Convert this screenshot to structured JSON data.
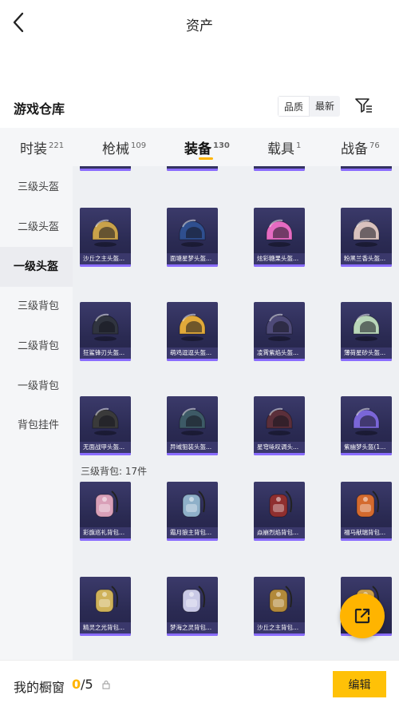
{
  "header": {
    "title": "资产",
    "back_icon": "chevron-left-icon"
  },
  "section": {
    "title": "游戏仓库",
    "sort_options": [
      "品质",
      "最新"
    ],
    "sort_selected": "品质",
    "filter_icon": "filter-icon"
  },
  "tabs": [
    {
      "label": "时装",
      "count": "221"
    },
    {
      "label": "枪械",
      "count": "109"
    },
    {
      "label": "装备",
      "count": "130",
      "active": true
    },
    {
      "label": "载具",
      "count": "1"
    },
    {
      "label": "战备",
      "count": "76"
    }
  ],
  "sidebar": [
    {
      "label": "三级头盔"
    },
    {
      "label": "二级头盔"
    },
    {
      "label": "一级头盔",
      "active": true
    },
    {
      "label": "三级背包"
    },
    {
      "label": "二级背包"
    },
    {
      "label": "一级背包"
    },
    {
      "label": "背包挂件"
    }
  ],
  "helmets": [
    {
      "label": "沙丘之主头盔...",
      "color": "#c9a24a"
    },
    {
      "label": "面塘星梦头盔...",
      "color": "#2f4f8f"
    },
    {
      "label": "炫彩糖果头盔...",
      "color": "#e56bc2"
    },
    {
      "label": "粉黑兰香头盔...",
      "color": "#d9c2be"
    },
    {
      "label": "狂鲨锋刃头盔...",
      "color": "#30343f"
    },
    {
      "label": "萌鸡逗逗头盔...",
      "color": "#e1a93a"
    },
    {
      "label": "凌霄紫焰头盔...",
      "color": "#4e4a78"
    },
    {
      "label": "薄荷星砂头盔...",
      "color": "#b9d6b9"
    },
    {
      "label": "无面战甲头盔...",
      "color": "#3a3a3a"
    },
    {
      "label": "异域狙装头盔...",
      "color": "#3d5a66"
    },
    {
      "label": "星穹咏叹调头...",
      "color": "#5b2f3a"
    },
    {
      "label": "紫幽梦头盔(1...",
      "color": "#7a66d8"
    }
  ],
  "backpack_group": {
    "label": "三级背包: 17件"
  },
  "backpacks": [
    {
      "label": "彩旗巡礼背包...",
      "color": "#d9a0b8"
    },
    {
      "label": "霜月狼主背包...",
      "color": "#8fb0c9"
    },
    {
      "label": "焱崩烈焰背包...",
      "color": "#8f2f2f"
    },
    {
      "label": "福马献瑞背包...",
      "color": "#d46a2e"
    },
    {
      "label": "精灵之光背包...",
      "color": "#cfb25a"
    },
    {
      "label": "梦海之灵背包...",
      "color": "#c9c9e6"
    },
    {
      "label": "沙丘之主背包...",
      "color": "#b2893a"
    },
    {
      "label": "",
      "color": "#cfa24a"
    }
  ],
  "fab": {
    "icon": "share-out-icon"
  },
  "closet": {
    "label": "我的橱窗",
    "current": "0",
    "total": "/5",
    "lock_icon": "lock-icon"
  },
  "edit_button": {
    "label": "编辑"
  }
}
